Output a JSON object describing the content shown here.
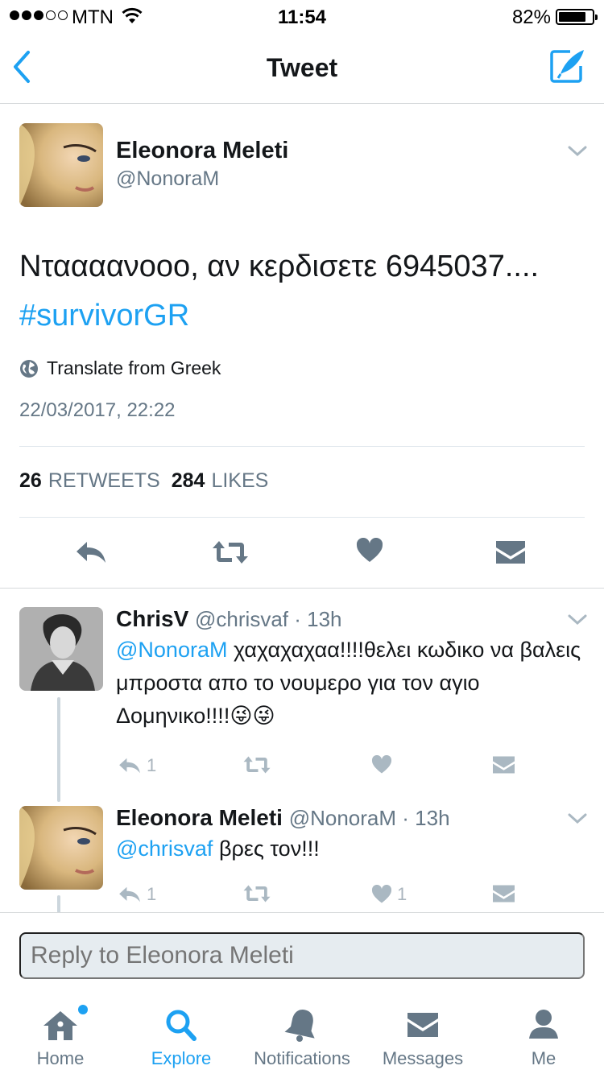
{
  "status": {
    "carrier": "MTN",
    "time": "11:54",
    "battery": "82%",
    "battery_level": 0.82
  },
  "nav": {
    "title": "Tweet"
  },
  "tweet": {
    "name": "Eleonora Meleti",
    "handle": "@NonoraM",
    "text": "Νταααανοοο, αν κερδισετε 6945037....",
    "hashtag": "#survivorGR",
    "translate": "Translate from Greek",
    "date": "22/03/2017, 22:22",
    "retweets_count": "26",
    "retweets_label": "RETWEETS",
    "likes_count": "284",
    "likes_label": "LIKES"
  },
  "replies": [
    {
      "name": "ChrisV",
      "meta": "@chrisvaf · 13h",
      "mention": "@NonoraM",
      "text": "χαχαχαχαα!!!!θελει κωδικο να βαλεις μπροστα απο το νουμερο για τον αγιο Δομηνικο!!!!😜😜",
      "reply_count": "1",
      "like_count": ""
    },
    {
      "name": "Eleonora Meleti",
      "meta": "@NonoraM · 13h",
      "mention": "@chrisvaf",
      "text": "βρες τον!!!",
      "reply_count": "1",
      "like_count": "1"
    }
  ],
  "reply_placeholder": "Reply to Eleonora Meleti",
  "tabs": [
    {
      "label": "Home",
      "icon": "home-icon"
    },
    {
      "label": "Explore",
      "icon": "search-icon"
    },
    {
      "label": "Notifications",
      "icon": "bell-icon"
    },
    {
      "label": "Messages",
      "icon": "envelope-icon"
    },
    {
      "label": "Me",
      "icon": "person-icon"
    }
  ],
  "colors": {
    "accent": "#1da1f2",
    "text": "#14171a",
    "muted": "#657786"
  }
}
